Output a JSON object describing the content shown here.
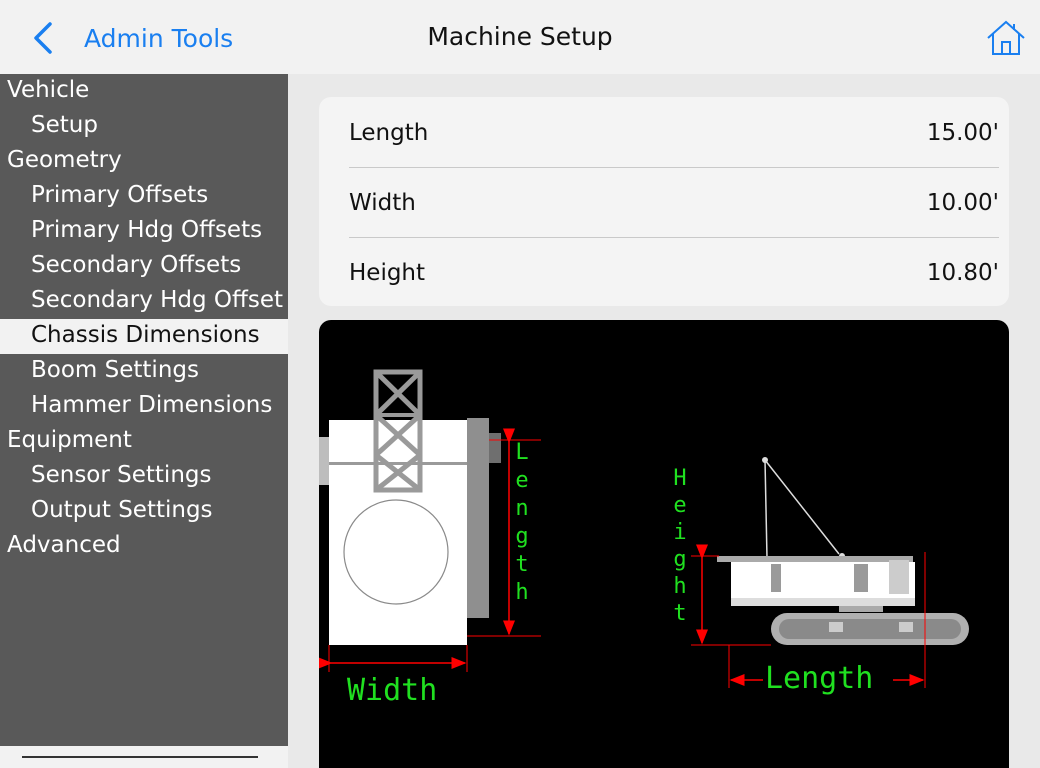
{
  "header": {
    "back_label": "Admin Tools",
    "title": "Machine Setup"
  },
  "sidebar": {
    "items": [
      {
        "label": "Vehicle",
        "type": "category"
      },
      {
        "label": "Setup",
        "type": "sub"
      },
      {
        "label": "Geometry",
        "type": "category"
      },
      {
        "label": "Primary Offsets",
        "type": "sub"
      },
      {
        "label": "Primary Hdg Offsets",
        "type": "sub"
      },
      {
        "label": "Secondary Offsets",
        "type": "sub"
      },
      {
        "label": "Secondary Hdg Offset",
        "type": "sub"
      },
      {
        "label": "Chassis Dimensions",
        "type": "sub",
        "active": true
      },
      {
        "label": "Boom Settings",
        "type": "sub"
      },
      {
        "label": "Hammer Dimensions",
        "type": "sub"
      },
      {
        "label": "Equipment",
        "type": "category"
      },
      {
        "label": "Sensor Settings",
        "type": "sub"
      },
      {
        "label": "Output Settings",
        "type": "sub"
      },
      {
        "label": "Advanced",
        "type": "category"
      }
    ]
  },
  "dimensions": {
    "rows": [
      {
        "label": "Length",
        "value": "15.00'"
      },
      {
        "label": "Width",
        "value": "10.00'"
      },
      {
        "label": "Height",
        "value": "10.80'"
      }
    ]
  },
  "diagram": {
    "length_label": "Length",
    "width_label": "Width",
    "height_label": "Height",
    "label_color": "#20e020",
    "arrow_color": "#ff0000"
  },
  "colors": {
    "accent": "#1a7ff0",
    "sidebar_bg": "#595959",
    "active_item_bg": "#f2f2f2"
  }
}
